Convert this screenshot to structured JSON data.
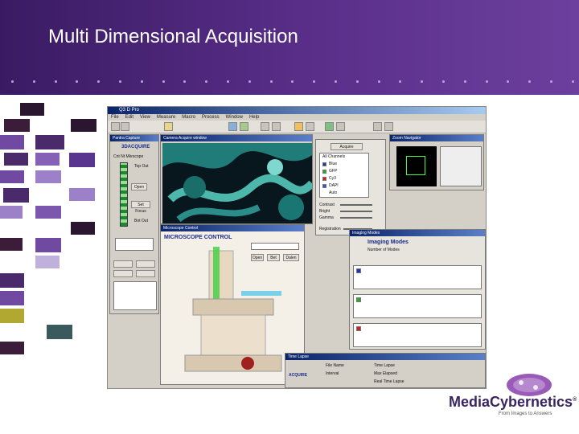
{
  "slide": {
    "title": "Multi Dimensional Acquisition",
    "colors": {
      "header": "#4a2574",
      "dot": "#b9a6d8"
    }
  },
  "app": {
    "window_title": "Q3 D Pro",
    "menu": [
      "File",
      "Edit",
      "View",
      "Measure",
      "Macro",
      "Process",
      "Window",
      "Help"
    ],
    "panels": {
      "sidebar": {
        "title": "Pantra Capture",
        "heading": "3DACQUIRE",
        "labels": [
          "Cnt Nt Mkrscope",
          "Top Out",
          "Bot Out",
          "Open",
          "Set Focus"
        ]
      },
      "image_view": {
        "title": "Camera Acquire window"
      },
      "microscope": {
        "title": "Microscope Control",
        "heading": "MICROSCOPE CONTROL",
        "labels": [
          "Open",
          "Bet",
          "Dalen"
        ]
      },
      "channels": {
        "title": "",
        "buttons": [
          "Acquire"
        ],
        "items": [
          "All Channels",
          "Blue",
          "GFP",
          "Cy3",
          "DAPI",
          "Auto"
        ],
        "sliders": [
          "Contrast",
          "Bright",
          "Gamma",
          "Registration"
        ]
      },
      "navigator": {
        "title": "Zoom Navigator",
        "heading": "Zoom Navigator"
      },
      "imaging_modes": {
        "title": "Imaging Modes",
        "heading": "Imaging Modes",
        "subtitle": "Number of Modes"
      },
      "time_lapse": {
        "title": "Time Lapse",
        "brand": "ACQUIRE",
        "labels": [
          "File Name",
          "Time Lapse",
          "Interval",
          "Max Elapsed",
          "Real Time Lapse"
        ]
      }
    }
  },
  "brand": {
    "logo_text": "MediaCybernetics",
    "registered": "®",
    "tagline": "From Images to Answers",
    "colors": {
      "logo": "#3a2560",
      "globe": "#9a5bb8"
    }
  },
  "icons": [
    "logo-icon",
    "microscope-icon",
    "camera-icon"
  ]
}
